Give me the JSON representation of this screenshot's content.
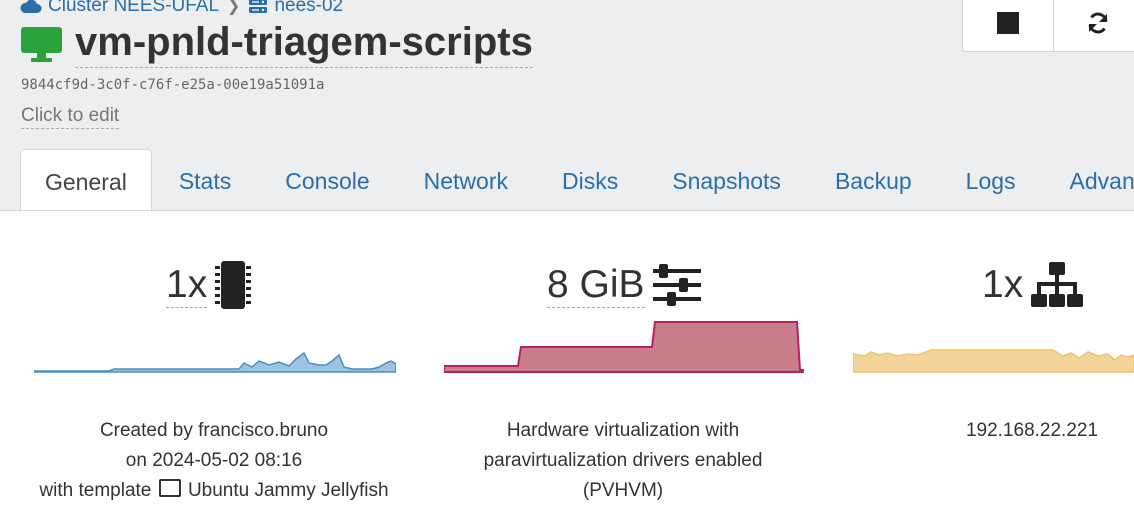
{
  "breadcrumb": {
    "cluster": "Cluster NEES-UFAL",
    "host": "nees-02"
  },
  "vm": {
    "name": "vm-pnld-triagem-scripts",
    "uuid": "9844cf9d-3c0f-c76f-e25a-00e19a51091a",
    "description_placeholder": "Click to edit",
    "power_state_color": "#2aa33c"
  },
  "actions": {
    "stop_icon": "stop-icon",
    "restart_icon": "refresh-icon"
  },
  "tabs": [
    {
      "label": "General",
      "active": true
    },
    {
      "label": "Stats"
    },
    {
      "label": "Console"
    },
    {
      "label": "Network"
    },
    {
      "label": "Disks"
    },
    {
      "label": "Snapshots"
    },
    {
      "label": "Backup"
    },
    {
      "label": "Logs"
    },
    {
      "label": "Advan"
    }
  ],
  "stats": {
    "cpu": {
      "value": "1x",
      "icon": "cpu-chip-icon",
      "color": "#4a8fc4"
    },
    "memory": {
      "value": "8 GiB",
      "icon": "sliders-icon",
      "color": "#c8707e"
    },
    "network": {
      "value": "1x",
      "icon": "network-icon",
      "color": "#f3cd86"
    }
  },
  "info": {
    "created_line1": "Created by francisco.bruno",
    "created_line2": "on 2024-05-02 08:16",
    "created_line3": "with template",
    "template_name": "Ubuntu Jammy Jellyfish",
    "virt_line1": "Hardware virtualization with",
    "virt_line2": "paravirtualization drivers enabled",
    "virt_line3": "(PVHVM)",
    "ip_address": "192.168.22.221"
  }
}
